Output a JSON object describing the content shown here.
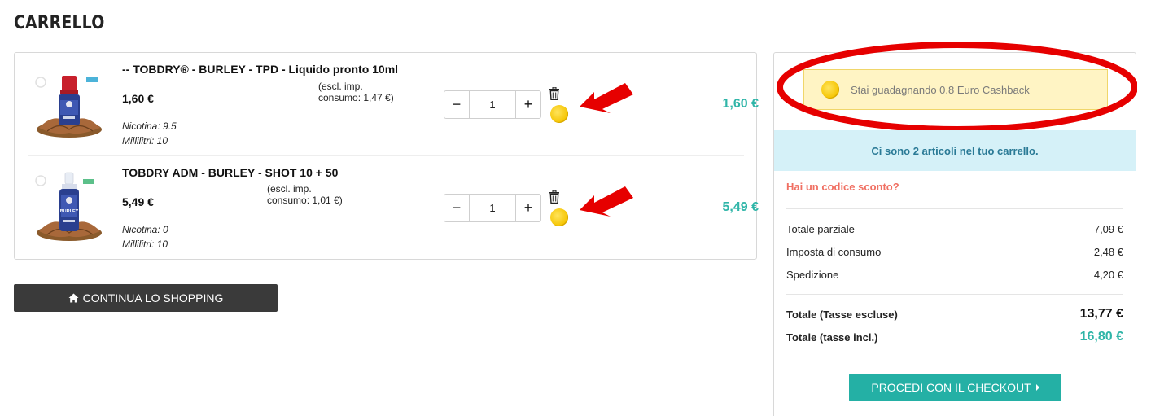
{
  "page": {
    "title": "CARRELLO"
  },
  "cart": {
    "items": [
      {
        "name": "-- TOBDRY® - BURLEY - TPD - Liquido pronto 10ml",
        "price": "1,60 €",
        "excl_note": "(escl. imp. consumo: 1,47 €)",
        "attr1": "Nicotina: 9.5",
        "attr2": "Millilitri: 10",
        "qty": "1",
        "qty_minus": "−",
        "qty_plus": "+",
        "total": "1,60 €",
        "bottle_cap_color": "#c8202c"
      },
      {
        "name": "TOBDRY ADM - BURLEY - SHOT 10 + 50",
        "price": "5,49 €",
        "excl_note": "(escl. imp. consumo: 1,01 €)",
        "attr1": "Nicotina: 0",
        "attr2": "Millilitri: 10",
        "qty": "1",
        "qty_minus": "−",
        "qty_plus": "+",
        "total": "5,49 €",
        "bottle_cap_color": "#e8edf5",
        "bottle_label_text": "BURLEY"
      }
    ],
    "continue_label": "CONTINUA LO SHOPPING"
  },
  "summary": {
    "cashback_text": "Stai guadagnando 0.8 Euro Cashback",
    "items_banner": "Ci sono 2 articoli nel tuo carrello.",
    "promo_link": "Hai un codice sconto?",
    "rows": [
      {
        "label": "Totale parziale",
        "value": "7,09 €"
      },
      {
        "label": "Imposta di consumo",
        "value": "2,48 €"
      },
      {
        "label": "Spedizione",
        "value": "4,20 €"
      }
    ],
    "total_excl": {
      "label": "Totale (Tasse escluse)",
      "value": "13,77 €"
    },
    "total_incl": {
      "label": "Totale (tasse incl.)",
      "value": "16,80 €"
    },
    "checkout_label": "PROCEDI CON IL CHECKOUT"
  },
  "colors": {
    "accent_teal": "#2fb5a8",
    "promo_red": "#f07063",
    "annotation_red": "#e60000",
    "coin_yellow": "#f5c400"
  },
  "icons": {
    "trash": "trash-icon",
    "coin": "coin-icon",
    "home": "home-icon",
    "caret": "caret-right-icon"
  }
}
